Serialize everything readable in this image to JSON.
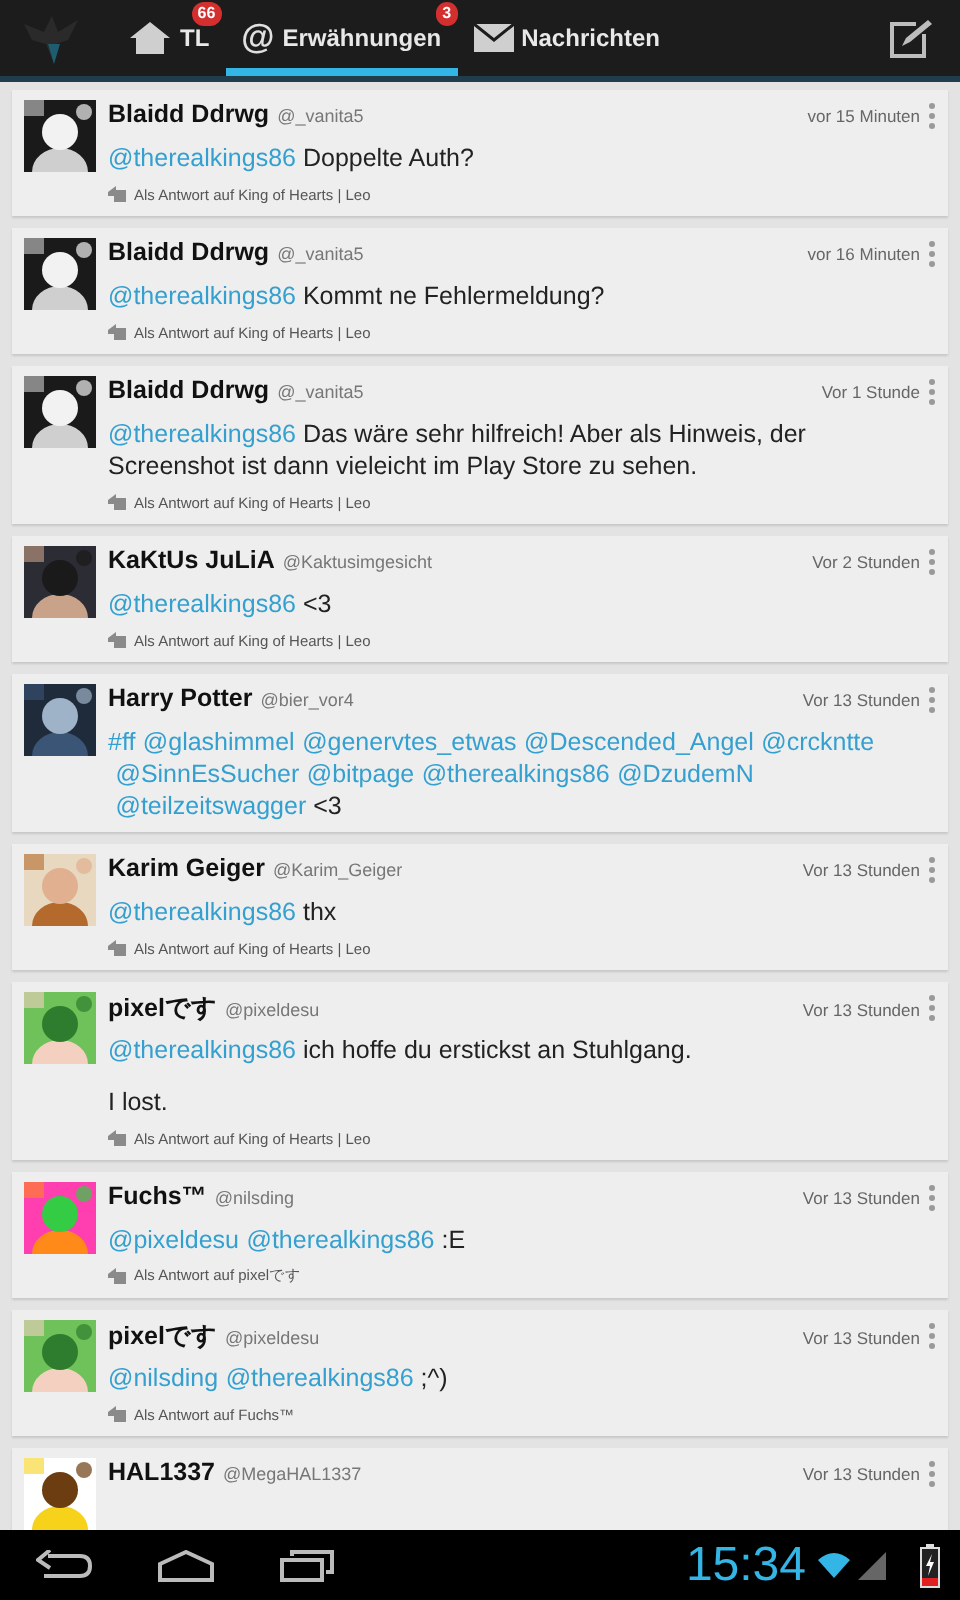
{
  "action_bar": {
    "tabs": [
      {
        "label": "TL",
        "badge": "66",
        "selected": false
      },
      {
        "icon": "@",
        "label": "Erwähnungen",
        "badge": "3",
        "selected": true
      },
      {
        "label": "Nachrichten",
        "selected": false
      }
    ]
  },
  "tweets": [
    {
      "name": "Blaidd Ddrwg",
      "handle": "@_vanita5",
      "time": "vor 15 Minuten",
      "paragraphs": [
        [
          {
            "text": "@therealkings86",
            "kind": "mention"
          },
          {
            "text": " Doppelte Auth?",
            "kind": "text"
          }
        ]
      ],
      "reply": "Als Antwort auf King of Hearts | Leo"
    },
    {
      "name": "Blaidd Ddrwg",
      "handle": "@_vanita5",
      "time": "vor 16 Minuten",
      "paragraphs": [
        [
          {
            "text": "@therealkings86",
            "kind": "mention"
          },
          {
            "text": " Kommt ne Fehlermeldung?",
            "kind": "text"
          }
        ]
      ],
      "reply": "Als Antwort auf King of Hearts | Leo"
    },
    {
      "name": "Blaidd Ddrwg",
      "handle": "@_vanita5",
      "time": "Vor 1 Stunde",
      "paragraphs": [
        [
          {
            "text": "@therealkings86",
            "kind": "mention"
          },
          {
            "text": " Das wäre sehr hilfreich! Aber als Hinweis, der Screenshot ist dann vieleicht im Play Store zu sehen.",
            "kind": "text"
          }
        ]
      ],
      "reply": "Als Antwort auf King of Hearts | Leo"
    },
    {
      "name": "KaKtUs JuLiA",
      "handle": "@Kaktusimgesicht",
      "time": "Vor 2 Stunden",
      "paragraphs": [
        [
          {
            "text": "@therealkings86",
            "kind": "mention"
          },
          {
            "text": " <3",
            "kind": "text"
          }
        ]
      ],
      "reply": "Als Antwort auf King of Hearts | Leo"
    },
    {
      "name": "Harry Potter",
      "handle": "@bier_vor4",
      "time": "Vor 13 Stunden",
      "paragraphs": [
        [
          {
            "text": "#ff",
            "kind": "mention"
          },
          {
            "text": "@glashimmel",
            "kind": "mention"
          },
          {
            "text": "@genervtes_etwas",
            "kind": "mention"
          },
          {
            "text": "@Descended_Angel",
            "kind": "mention"
          },
          {
            "text": "@crckntte",
            "kind": "mention"
          },
          {
            "text": "@SinnEsSucher",
            "kind": "mention"
          },
          {
            "text": "@bitpage",
            "kind": "mention"
          },
          {
            "text": "@therealkings86",
            "kind": "mention"
          },
          {
            "text": "@DzudemN",
            "kind": "mention"
          },
          {
            "text": "@teilzeitswagger",
            "kind": "mention"
          },
          {
            "text": " <3",
            "kind": "text"
          }
        ]
      ]
    },
    {
      "name": "Karim Geiger",
      "handle": "@Karim_Geiger",
      "time": "Vor 13 Stunden",
      "paragraphs": [
        [
          {
            "text": "@therealkings86",
            "kind": "mention"
          },
          {
            "text": " thx",
            "kind": "text"
          }
        ]
      ],
      "reply": "Als Antwort auf King of Hearts | Leo"
    },
    {
      "name": "pixelです",
      "handle": "@pixeldesu",
      "time": "Vor 13 Stunden",
      "paragraphs": [
        [
          {
            "text": "@therealkings86",
            "kind": "mention"
          },
          {
            "text": " ich hoffe du erstickst an Stuhlgang.",
            "kind": "text"
          }
        ],
        [
          {
            "text": "I lost.",
            "kind": "text"
          }
        ]
      ],
      "reply": "Als Antwort auf King of Hearts | Leo"
    },
    {
      "name": "Fuchs™",
      "handle": "@nilsding",
      "time": "Vor 13 Stunden",
      "paragraphs": [
        [
          {
            "text": "@pixeldesu",
            "kind": "mention"
          },
          {
            "text": "@therealkings86",
            "kind": "mention"
          },
          {
            "text": " :E",
            "kind": "text"
          }
        ]
      ],
      "reply": "Als Antwort auf pixelです"
    },
    {
      "name": "pixelです",
      "handle": "@pixeldesu",
      "time": "Vor 13 Stunden",
      "paragraphs": [
        [
          {
            "text": "@nilsding",
            "kind": "mention"
          },
          {
            "text": "@therealkings86",
            "kind": "mention"
          },
          {
            "text": " ;^)",
            "kind": "text"
          }
        ]
      ],
      "reply": "Als Antwort auf Fuchs™"
    },
    {
      "name": "HAL1337",
      "handle": "@MegaHAL1337",
      "time": "Vor 13 Stunden"
    }
  ],
  "status_bar": {
    "clock": "15:34"
  }
}
